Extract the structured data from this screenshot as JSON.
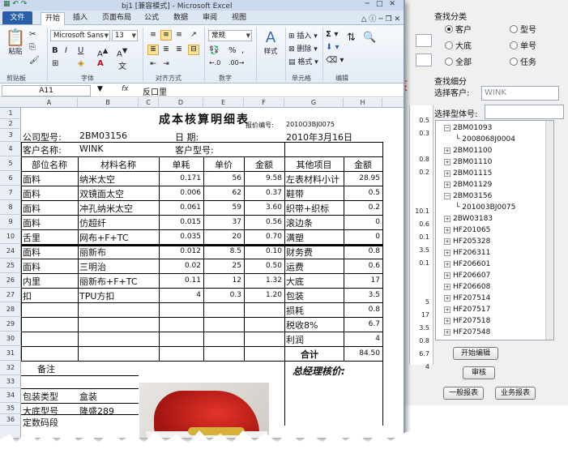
{
  "window_title": "bj1 [兼容模式] - Microsoft Excel",
  "tabs": [
    "文件",
    "开始",
    "插入",
    "页面布局",
    "公式",
    "数据",
    "审阅",
    "视图"
  ],
  "ribbon": {
    "font_name": "Microsoft Sans",
    "font_size": "13",
    "number_format": "常规",
    "paste_label": "粘贴",
    "styles_label": "样式",
    "insert_label": "插入",
    "delete_label": "删除",
    "format_label": "格式",
    "groups": [
      "剪贴板",
      "字体",
      "对齐方式",
      "数字",
      "单元格",
      "编辑"
    ]
  },
  "formula_bar": {
    "name_box": "A11",
    "fx": "fx",
    "value": "反口里"
  },
  "columns": [
    "A",
    "B",
    "C",
    "D",
    "E",
    "F",
    "G",
    "H"
  ],
  "rows": [
    "1",
    "2",
    "3",
    "4",
    "5",
    "6",
    "7",
    "8",
    "9",
    "10",
    "24",
    "25",
    "26",
    "27",
    "28",
    "29",
    "30",
    "31",
    "32",
    "33",
    "34",
    "35",
    "36"
  ],
  "sheet": {
    "title": "成本核算明细表",
    "quote_label": "报价编号:",
    "quote_no": "2010O3BJ0075",
    "company_model_label": "公司型号:",
    "company_model": "2BM03156",
    "date_label": "日    期:",
    "date": "2010年3月16日",
    "customer_label": "客户名称:",
    "customer": "WINK",
    "customer_model_label": "客户型号:",
    "headers": [
      "部位名称",
      "材料名称",
      "单耗",
      "单价",
      "金额",
      "其他项目",
      "金额"
    ],
    "rows": [
      [
        "面料",
        "纳米太空",
        "0.171",
        "56",
        "9.58",
        "左表材料小计",
        "28.95"
      ],
      [
        "面料",
        "双镜面太空",
        "0.006",
        "62",
        "0.37",
        "鞋带",
        "0.5"
      ],
      [
        "面料",
        "冲孔纳米太空",
        "0.061",
        "59",
        "3.60",
        "织带+织标",
        "0.2"
      ],
      [
        "面料",
        "仿超纤",
        "0.015",
        "37",
        "0.56",
        "滚边条",
        "0"
      ],
      [
        "舌里",
        "网布+F+TC",
        "0.035",
        "20",
        "0.70",
        "满塑",
        "0"
      ],
      [
        "面料",
        "丽新布",
        "0.012",
        "8.5",
        "0.10",
        "财务费",
        "0.8"
      ],
      [
        "面料",
        "三明治",
        "0.02",
        "25",
        "0.50",
        "运费",
        "0.6"
      ],
      [
        "内里",
        "丽新布+F+TC",
        "0.11",
        "12",
        "1.32",
        "大底",
        "17"
      ],
      [
        "扣",
        "TPU方扣",
        "4",
        "0.3",
        "1.20",
        "包装",
        "3.5"
      ],
      [
        "",
        "",
        "",
        "",
        "",
        "损耗",
        "0.8"
      ],
      [
        "",
        "",
        "",
        "",
        "",
        "税收8%",
        "6.7"
      ],
      [
        "",
        "",
        "",
        "",
        "",
        "利润",
        "4"
      ]
    ],
    "total_label": "合计",
    "total_value": "84.50",
    "remarks_label": "备注",
    "gm_label": "总经理核价:",
    "pack_type_label": "包装类型",
    "pack_type": "盒装",
    "sole_model_label": "大底型号",
    "sole_model": "隆盛289",
    "code_label": "定数码段"
  },
  "right_panel": {
    "query_label": "查找分类",
    "radios": [
      {
        "label": "客户",
        "checked": true
      },
      {
        "label": "型号",
        "checked": false
      },
      {
        "label": "大底",
        "checked": false
      },
      {
        "label": "单号",
        "checked": false
      },
      {
        "label": "全部",
        "checked": false
      },
      {
        "label": "任务",
        "checked": false
      }
    ],
    "detail_label": "查找细分",
    "select_customer_label": "选择客户:",
    "select_customer_value": "WINK",
    "select_model_label": "选择型体号:",
    "tree": [
      {
        "label": "2BM01093",
        "level": 0,
        "expanded": true
      },
      {
        "label": "2008068J0004",
        "level": 1,
        "expanded": false
      },
      {
        "label": "2BM01100",
        "level": 0,
        "expanded": false
      },
      {
        "label": "2BM01110",
        "level": 0,
        "expanded": false
      },
      {
        "label": "2BM01115",
        "level": 0,
        "expanded": false
      },
      {
        "label": "2BM01129",
        "level": 0,
        "expanded": false
      },
      {
        "label": "2BM03156",
        "level": 0,
        "expanded": true
      },
      {
        "label": "201003BJ0075",
        "level": 1,
        "expanded": false
      },
      {
        "label": "2BW03183",
        "level": 0,
        "expanded": false
      },
      {
        "label": "HF201065",
        "level": 0,
        "expanded": false
      },
      {
        "label": "HF205328",
        "level": 0,
        "expanded": false
      },
      {
        "label": "HF206311",
        "level": 0,
        "expanded": false
      },
      {
        "label": "HF206601",
        "level": 0,
        "expanded": false
      },
      {
        "label": "HF206607",
        "level": 0,
        "expanded": false
      },
      {
        "label": "HF206608",
        "level": 0,
        "expanded": false
      },
      {
        "label": "HF207514",
        "level": 0,
        "expanded": false
      },
      {
        "label": "HF207517",
        "level": 0,
        "expanded": false
      },
      {
        "label": "HF207518",
        "level": 0,
        "expanded": false
      },
      {
        "label": "HF207548",
        "level": 0,
        "expanded": false
      }
    ],
    "buttons": {
      "start_edit": "开始编辑",
      "review": "审核",
      "general_report": "一般报表",
      "business_report": "业务报表"
    },
    "mid_numbers": [
      "0.5",
      "0.3",
      "0.8",
      "0.2",
      "10.1",
      "0.6",
      "0.1",
      "3.5",
      "0.1",
      "5",
      "17",
      "3.5",
      "0.8",
      "6.7",
      "4"
    ],
    "red_char": "核"
  }
}
